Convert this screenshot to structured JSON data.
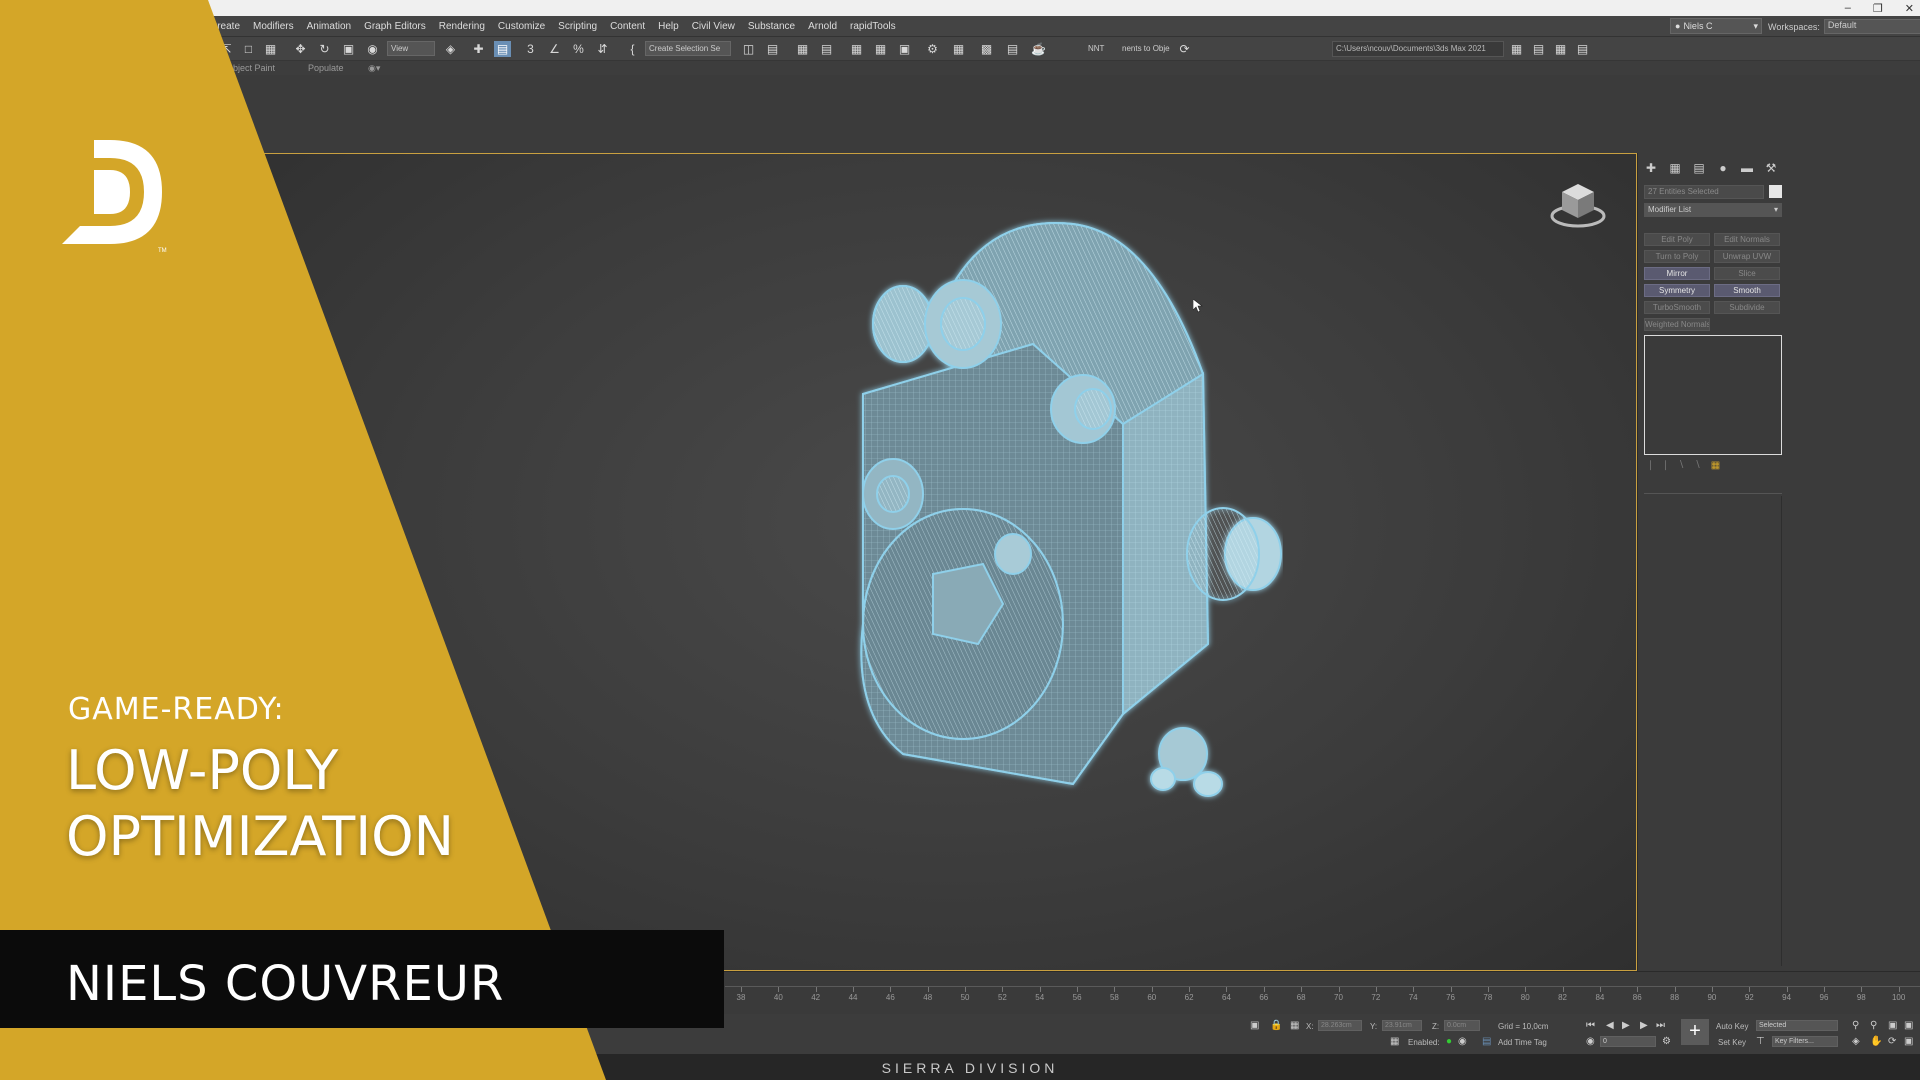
{
  "menu": {
    "items": [
      "Create",
      "Modifiers",
      "Animation",
      "Graph Editors",
      "Rendering",
      "Customize",
      "Scripting",
      "Content",
      "Help",
      "Civil View",
      "Substance",
      "Arnold",
      "rapidTools"
    ],
    "user": "Niels C",
    "workspaces_label": "Workspaces:",
    "workspaces_value": "Default"
  },
  "toolbar": {
    "view_dropdown": "View",
    "selection_set": "Create Selection Se",
    "nnt_label": "NNT",
    "convert_label": "nents to Obje",
    "project_path": "C:\\Users\\ncouv\\Documents\\3ds Max 2021"
  },
  "ribbon": {
    "object_paint": "Object Paint",
    "populate": "Populate"
  },
  "command_panel": {
    "selection_info": "27 Entities Selected",
    "modifier_list": "Modifier List",
    "modifier_buttons": [
      {
        "label": "Edit Poly",
        "active": false
      },
      {
        "label": "Edit Normals",
        "active": false
      },
      {
        "label": "Turn to Poly",
        "active": false
      },
      {
        "label": "Unwrap UVW",
        "active": false
      },
      {
        "label": "Mirror",
        "active": true
      },
      {
        "label": "Slice",
        "active": false
      },
      {
        "label": "Symmetry",
        "active": true
      },
      {
        "label": "Smooth",
        "active": true
      },
      {
        "label": "TurboSmooth",
        "active": false
      },
      {
        "label": "Subdivide",
        "active": false
      },
      {
        "label": "Weighted Normals",
        "active": false
      }
    ]
  },
  "timeline": {
    "ticks": [
      "38",
      "40",
      "42",
      "44",
      "46",
      "48",
      "50",
      "52",
      "54",
      "56",
      "58",
      "60",
      "62",
      "64",
      "66",
      "68",
      "70",
      "72",
      "74",
      "76",
      "78",
      "80",
      "82",
      "84",
      "86",
      "88",
      "90",
      "92",
      "94",
      "96",
      "98",
      "100"
    ]
  },
  "status": {
    "x_label": "X:",
    "x_value": "28.263cm",
    "y_label": "Y:",
    "y_value": "23.91cm",
    "z_label": "Z:",
    "z_value": "0.0cm",
    "grid": "Grid = 10,0cm",
    "enabled_label": "Enabled:",
    "add_time_tag": "Add Time Tag",
    "auto_key": "Auto Key",
    "selected": "Selected",
    "set_key": "Set Key",
    "key_filters": "Key Filters...",
    "frame": "0"
  },
  "overlay": {
    "kicker": "GAME-READY:",
    "headline_line1": "LOW-POLY",
    "headline_line2": "OPTIMIZATION",
    "author": "NIELS COUVREUR",
    "watermark": "SIERRA DIVISION",
    "trademark": "TM",
    "accent_color": "#d4a628",
    "name_bar_color": "#0b0b0b",
    "wireframe_color": "#8fd0ea"
  }
}
